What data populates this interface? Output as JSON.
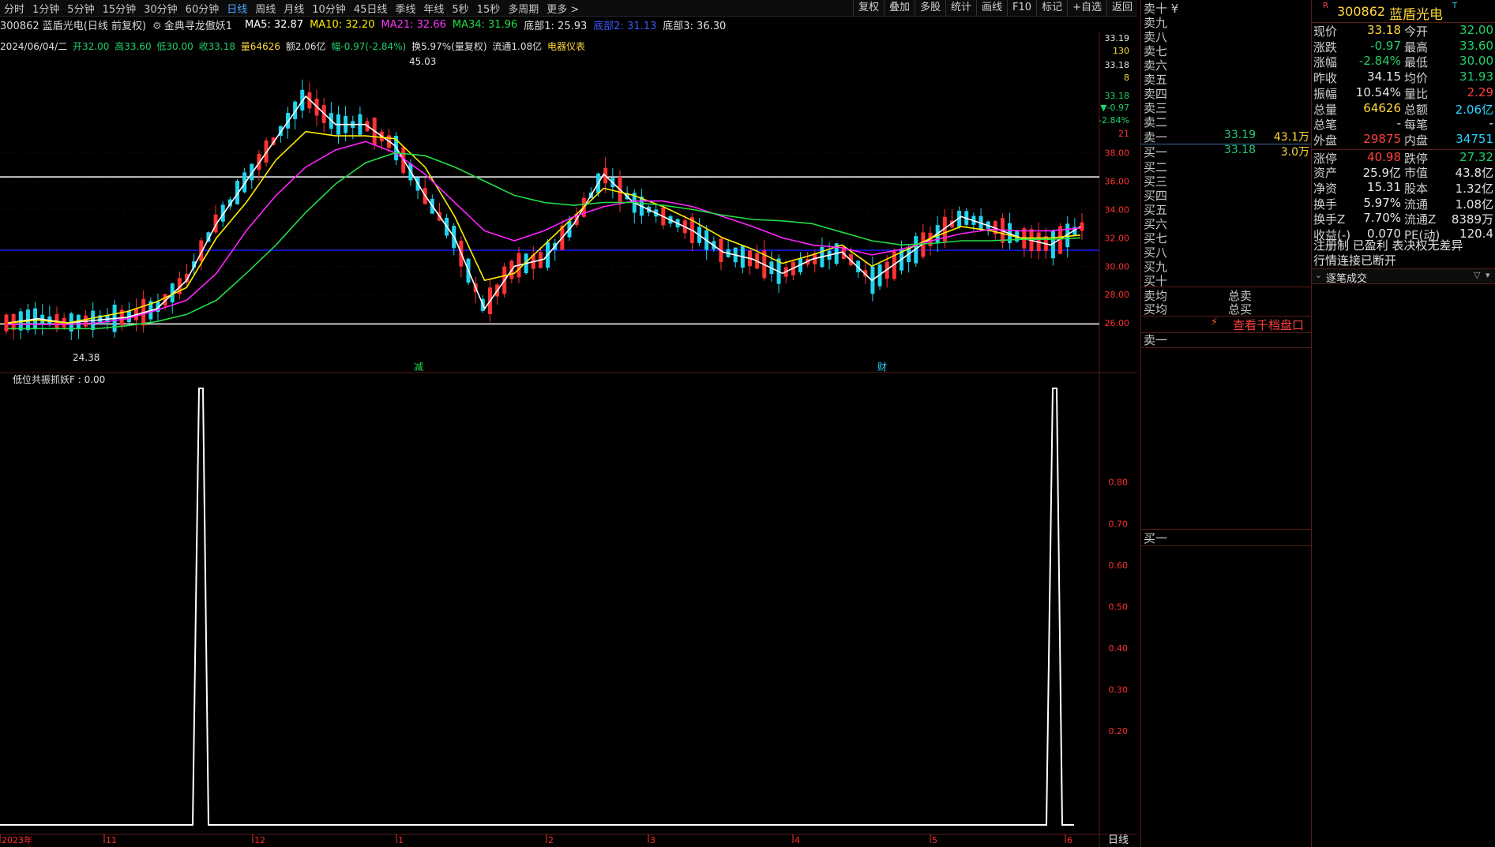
{
  "toolbar": {
    "timeframes": [
      "分时",
      "1分钟",
      "5分钟",
      "15分钟",
      "30分钟",
      "60分钟",
      "日线",
      "周线",
      "月线",
      "10分钟",
      "45日线",
      "季线",
      "年线",
      "5秒",
      "15秒",
      "多周期",
      "更多 >"
    ],
    "active_index": 6,
    "right_tools": [
      "复权",
      "叠加",
      "多股",
      "统计",
      "画线",
      "F10",
      "标记",
      "+自选",
      "返回"
    ]
  },
  "info": {
    "code_name": "300862 蓝盾光电(日线 前复权)",
    "indicator_name": "金典寻龙傲妖1",
    "ma5": "MA5: 32.87",
    "ma10": "MA10: 32.20",
    "ma21": "MA21: 32.66",
    "ma34": "MA34: 31.96",
    "bottom1": "底部1: 25.93",
    "bottom2": "底部2: 31.13",
    "bottom3": "底部3: 36.30"
  },
  "ohlc": {
    "date": "2024/06/04/二",
    "open": "开32.00",
    "high": "高33.60",
    "low": "低30.00",
    "close": "收33.18",
    "volume": "量64626",
    "amount": "额2.06亿",
    "change": "幅-0.97(-2.84%)",
    "turnover": "换5.97%(量复权)",
    "float": "流通1.08亿",
    "sector": "电器仪表"
  },
  "axis": {
    "price_ticks": [
      "38.00",
      "36.00",
      "34.00",
      "32.00",
      "30.00",
      "28.00",
      "26.00"
    ],
    "right_quote": [
      "33.19",
      "130",
      "33.18",
      "8",
      "33.18",
      "▼-0.97",
      "-2.84%",
      "21"
    ],
    "indicator_ticks": [
      "0.80",
      "0.70",
      "0.60",
      "0.50",
      "0.40",
      "0.30",
      "0.20"
    ],
    "date_labels": [
      "2023年",
      "11",
      "12",
      "1",
      "2",
      "3",
      "4",
      "5",
      "6"
    ],
    "period_label": "日线"
  },
  "chart_labels": {
    "high_mark": "45.03",
    "low_mark": "24.38",
    "signal_a": "减",
    "signal_b": "财",
    "indicator_title": "低位共振抓妖F : 0.00"
  },
  "chart_data": {
    "type": "line",
    "x": [
      "2023-10",
      "2023-11",
      "2023-12",
      "2024-01",
      "2024-02",
      "2024-03",
      "2024-04",
      "2024-05",
      "2024-06"
    ],
    "price_range": [
      24.38,
      45.03
    ],
    "levels": [
      {
        "name": "底部1",
        "value": 25.93,
        "color": "#ffffff"
      },
      {
        "name": "底部2",
        "value": 31.13,
        "color": "#1a1aff"
      },
      {
        "name": "底部3",
        "value": 36.3,
        "color": "#ffffff"
      }
    ],
    "series": [
      {
        "name": "MA5",
        "color": "#ffffff",
        "values": [
          26.0,
          26.3,
          26.0,
          26.2,
          26.4,
          27.0,
          29.0,
          33.0,
          36.0,
          39.0,
          42.0,
          40.0,
          40.0,
          38.5,
          35.0,
          32.0,
          27.0,
          30.0,
          30.5,
          33.0,
          36.5,
          34.5,
          33.5,
          32.5,
          31.0,
          30.5,
          29.5,
          30.5,
          31.0,
          29.0,
          30.5,
          32.0,
          33.5,
          32.8,
          32.0,
          31.5,
          32.8
        ]
      },
      {
        "name": "MA10",
        "color": "#ffee00",
        "values": [
          26.0,
          26.2,
          26.0,
          26.4,
          26.8,
          27.5,
          28.5,
          32.0,
          34.5,
          37.5,
          39.5,
          39.2,
          39.2,
          39.0,
          37.0,
          33.5,
          29.0,
          29.5,
          31.5,
          33.5,
          35.5,
          35.0,
          34.2,
          33.2,
          32.0,
          31.2,
          30.2,
          30.8,
          31.5,
          30.0,
          31.0,
          32.0,
          32.8,
          32.5,
          32.0,
          32.0,
          32.2
        ]
      },
      {
        "name": "MA21",
        "color": "#ff22ff",
        "values": [
          25.9,
          25.9,
          25.9,
          26.0,
          26.3,
          26.9,
          27.6,
          29.5,
          32.5,
          35.0,
          37.0,
          38.2,
          38.8,
          38.0,
          36.5,
          34.5,
          32.5,
          31.8,
          32.5,
          33.5,
          34.2,
          34.6,
          34.6,
          34.2,
          33.5,
          32.8,
          32.0,
          31.5,
          31.3,
          30.8,
          31.2,
          31.8,
          32.3,
          32.6,
          32.5,
          32.5,
          32.7
        ]
      },
      {
        "name": "MA34",
        "color": "#22dd44",
        "values": [
          25.6,
          25.6,
          25.6,
          25.6,
          25.8,
          26.1,
          26.6,
          27.6,
          29.5,
          31.5,
          33.8,
          35.8,
          37.3,
          38.0,
          37.8,
          37.0,
          36.0,
          35.0,
          34.5,
          34.3,
          34.5,
          34.5,
          34.3,
          34.0,
          33.6,
          33.3,
          33.2,
          33.0,
          32.4,
          31.8,
          31.5,
          31.6,
          31.8,
          31.8,
          31.9,
          31.9,
          32.0
        ]
      }
    ],
    "indicator": {
      "name": "低位共振抓妖F",
      "spikes": [
        1,
        1
      ],
      "baseline": 0
    }
  },
  "orderbook": {
    "sell_labels": [
      "卖十 ¥",
      "卖九",
      "卖八",
      "卖七",
      "卖六",
      "卖五",
      "卖四",
      "卖三",
      "卖二"
    ],
    "sell1": {
      "label": "卖一",
      "price": "33.19",
      "vol": "43.1万"
    },
    "buy1": {
      "label": "买一",
      "price": "33.18",
      "vol": "3.0万"
    },
    "buy_labels": [
      "买二",
      "买三",
      "买四",
      "买五",
      "买六",
      "买七",
      "买八",
      "买九",
      "买十"
    ],
    "avg": [
      {
        "l": "卖均",
        "r": "总卖"
      },
      {
        "l": "买均",
        "r": "总买"
      }
    ],
    "view_link": "查看千档盘口",
    "lower_sell": "卖一",
    "lower_buy": "买一"
  },
  "quote": {
    "badge": "R",
    "code": "300862",
    "name": "蓝盾光电",
    "rows": [
      [
        "现价",
        "33.18",
        "今开",
        "32.00"
      ],
      [
        "涨跌",
        "-0.97",
        "最高",
        "33.60"
      ],
      [
        "涨幅",
        "-2.84%",
        "最低",
        "30.00"
      ],
      [
        "昨收",
        "34.15",
        "均价",
        "31.93"
      ],
      [
        "振幅",
        "10.54%",
        "量比",
        "2.29"
      ],
      [
        "总量",
        "64626",
        "总额",
        "2.06亿"
      ],
      [
        "总笔",
        "-",
        "每笔",
        "-"
      ],
      [
        "外盘",
        "29875",
        "内盘",
        "34751"
      ],
      [
        "涨停",
        "40.98",
        "跌停",
        "27.32"
      ],
      [
        "资产",
        "25.9亿",
        "市值",
        "43.8亿"
      ],
      [
        "净资",
        "15.31",
        "股本",
        "1.32亿"
      ],
      [
        "换手",
        "5.97%",
        "流通",
        "1.08亿"
      ],
      [
        "换手Z",
        "7.70%",
        "流通Z",
        "8389万"
      ],
      [
        "收益(-)",
        "0.070",
        "PE(动)",
        "120.4"
      ]
    ],
    "note1": "注册制 已盈利 表决权无差异",
    "note2": "行情连接已断开",
    "tick_title": "逐笔成交"
  },
  "colors": {
    "up": "#ff3333",
    "down": "#22d4ee",
    "price_green": "#22c97a",
    "volume_yellow": "#ffd83c"
  }
}
